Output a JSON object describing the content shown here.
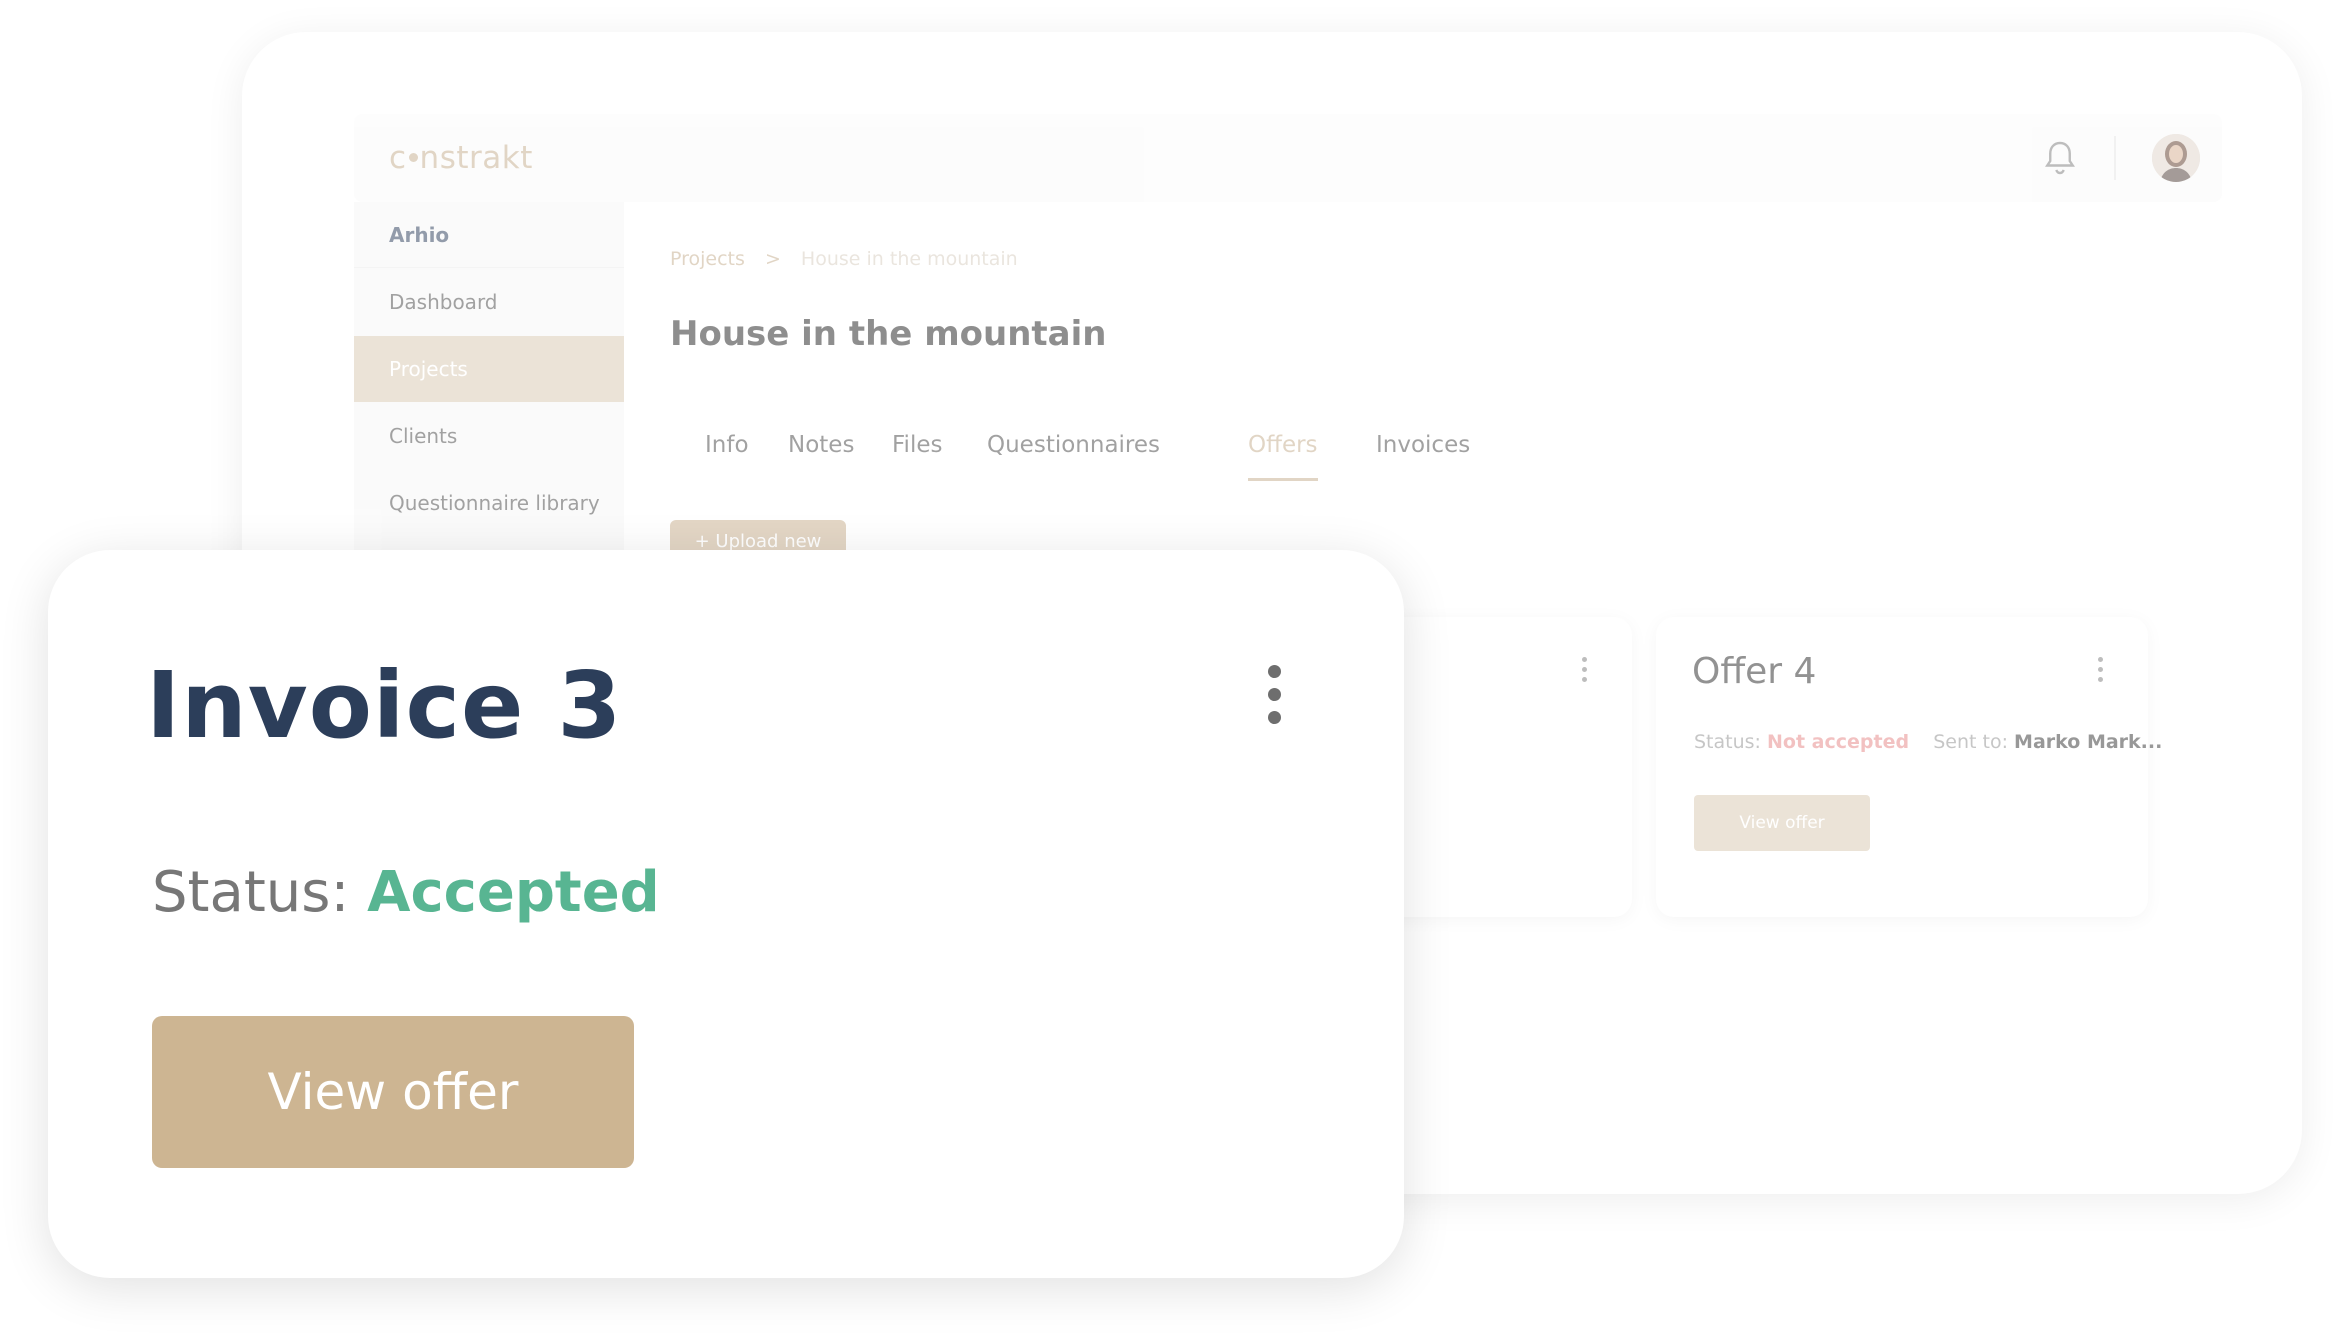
{
  "app": {
    "logo_left": "c",
    "logo_right": "nstrakt"
  },
  "sidebar": {
    "items": [
      {
        "label": "Arhio"
      },
      {
        "label": "Dashboard"
      },
      {
        "label": "Projects"
      },
      {
        "label": "Clients"
      },
      {
        "label": "Questionnaire library"
      }
    ]
  },
  "breadcrumb": {
    "root": "Projects",
    "separator": ">",
    "current": "House in the mountain"
  },
  "page": {
    "title": "House in the mountain",
    "upload_label": "+ Upload new"
  },
  "tabs": [
    {
      "label": "Info"
    },
    {
      "label": "Notes"
    },
    {
      "label": "Files"
    },
    {
      "label": "Questionnaires"
    },
    {
      "label": "Offers"
    },
    {
      "label": "Invoices"
    }
  ],
  "active_tab": "Offers",
  "offer_card": {
    "title": "Offer 4",
    "status_label": "Status:",
    "status_value": "Not accepted",
    "sent_label": "Sent to:",
    "sent_value": "Marko Mark...",
    "button": "View offer"
  },
  "invoice_card": {
    "title": "Invoice 3",
    "status_label": "Status:",
    "status_value": "Accepted",
    "button": "View offer"
  },
  "colors": {
    "accent": "#cdb592",
    "accepted": "#58b592",
    "not_accepted": "#e89090",
    "title": "#2c3e5a"
  },
  "icons": [
    "bell-icon",
    "user-avatar",
    "more-vertical-icon"
  ]
}
